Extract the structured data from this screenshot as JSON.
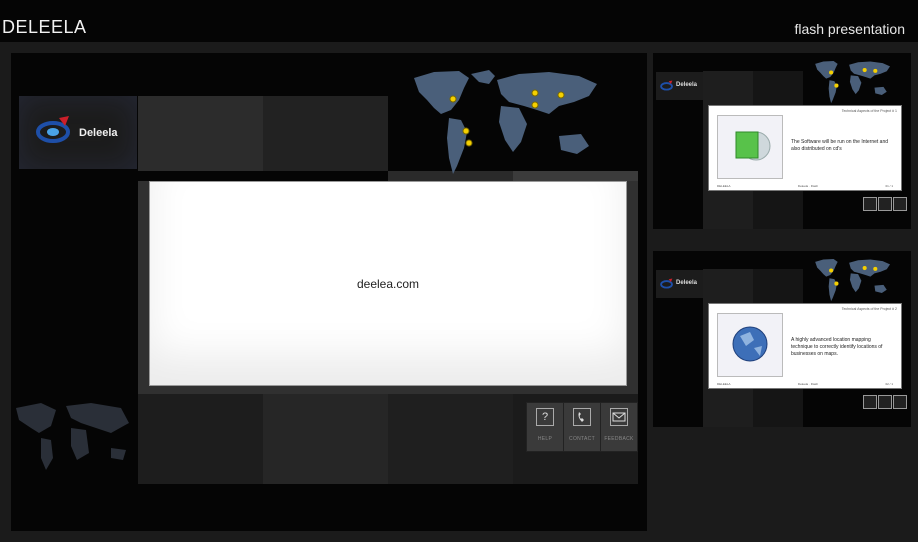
{
  "header": {
    "brand": "DELEELA",
    "subtitle": "flash presentation"
  },
  "main": {
    "logo_text": "Deleela",
    "center_text": "deelea.com",
    "buttons": [
      {
        "label": "HELP",
        "icon": "?"
      },
      {
        "label": "CONTACT",
        "icon": "phone"
      },
      {
        "label": "FEEDBACK",
        "icon": "envelope"
      }
    ]
  },
  "side_panels": [
    {
      "logo_text": "Deleela",
      "slide_header": "Technical Aspects of the Project # 1",
      "slide_text": "The Software will be run on the Internet and also distributed on cd's",
      "footer_left": "DELEELA",
      "footer_mid": "Deleela · Flash",
      "footer_right": "01 / 1"
    },
    {
      "logo_text": "Deleela",
      "slide_header": "Technical Aspects of the Project # 2",
      "slide_text": "A highly advanced location mapping technique to correctly identify locations of businesses on maps.",
      "footer_left": "DELEELA",
      "footer_mid": "Deleela · Flash",
      "footer_right": "02 / 1"
    }
  ],
  "colors": {
    "map": "#4a5f7a",
    "pin": "#f5d000",
    "logo_blue": "#1e4fa8",
    "logo_red": "#cc1f2a"
  }
}
